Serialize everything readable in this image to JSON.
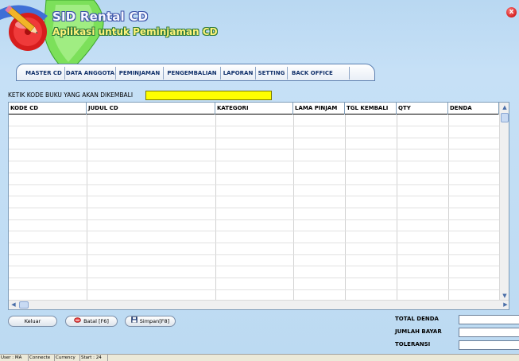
{
  "app": {
    "title": "SID Rental CD",
    "subtitle": "Aplikasi untuk Peminjaman CD",
    "close_glyph": "x"
  },
  "tabs": [
    {
      "label": "MASTER CD"
    },
    {
      "label": "DATA ANGGOTA"
    },
    {
      "label": "PEMINJAMAN"
    },
    {
      "label": "PENGEMBALIAN"
    },
    {
      "label": "LAPORAN"
    },
    {
      "label": "SETTING"
    },
    {
      "label": "BACK OFFICE"
    }
  ],
  "search": {
    "label": "KETIK KODE BUKU YANG AKAN DIKEMBALI",
    "value": "",
    "color": "#ffff00"
  },
  "table": {
    "columns": [
      "KODE CD",
      "JUDUL CD",
      "KATEGORI",
      "LAMA PINJAM",
      "TGL KEMBALI",
      "QTY",
      "DENDA"
    ],
    "rows": []
  },
  "buttons": {
    "keluar": "Keluar",
    "batal": "Batal [F6]",
    "simpan": "Simpan[F8]"
  },
  "totals": {
    "total_denda_label": "TOTAL DENDA",
    "total_denda_value": "",
    "jumlah_bayar_label": "JUMLAH BAYAR",
    "jumlah_bayar_value": "",
    "toleransi_label": "TOLERANSI",
    "toleransi_value": ""
  },
  "status_bar": [
    "User : MA",
    "Connecte",
    "Currency",
    "Start : 24"
  ],
  "icons": {
    "logo": "cd-pencil-logo-icon",
    "close": "close-icon",
    "batal": "cancel-icon",
    "simpan": "floppy-disk-icon"
  },
  "colors": {
    "background": "#b9d8f2",
    "tab_text": "#10306a",
    "search_highlight": "#ffff00",
    "close_button": "#d42020"
  }
}
